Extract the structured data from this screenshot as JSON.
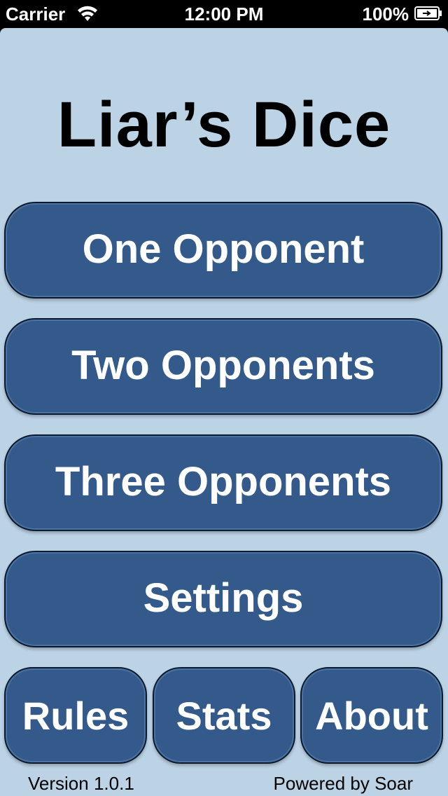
{
  "status_bar": {
    "carrier": "Carrier",
    "time": "12:00 PM",
    "battery": "100%",
    "wifi_icon": "wifi-icon",
    "battery_icon": "battery-charging-icon"
  },
  "title": "Liar’s Dice",
  "menu": {
    "one_opponent": "One Opponent",
    "two_opponents": "Two Opponents",
    "three_opponents": "Three Opponents",
    "settings": "Settings",
    "rules": "Rules",
    "stats": "Stats",
    "about": "About"
  },
  "footer": {
    "version": "Version 1.0.1",
    "powered_by": "Powered by Soar"
  },
  "colors": {
    "background": "#bcd3e6",
    "button": "#335a8a",
    "button_text": "#ffffff",
    "status_bar": "#000000"
  }
}
